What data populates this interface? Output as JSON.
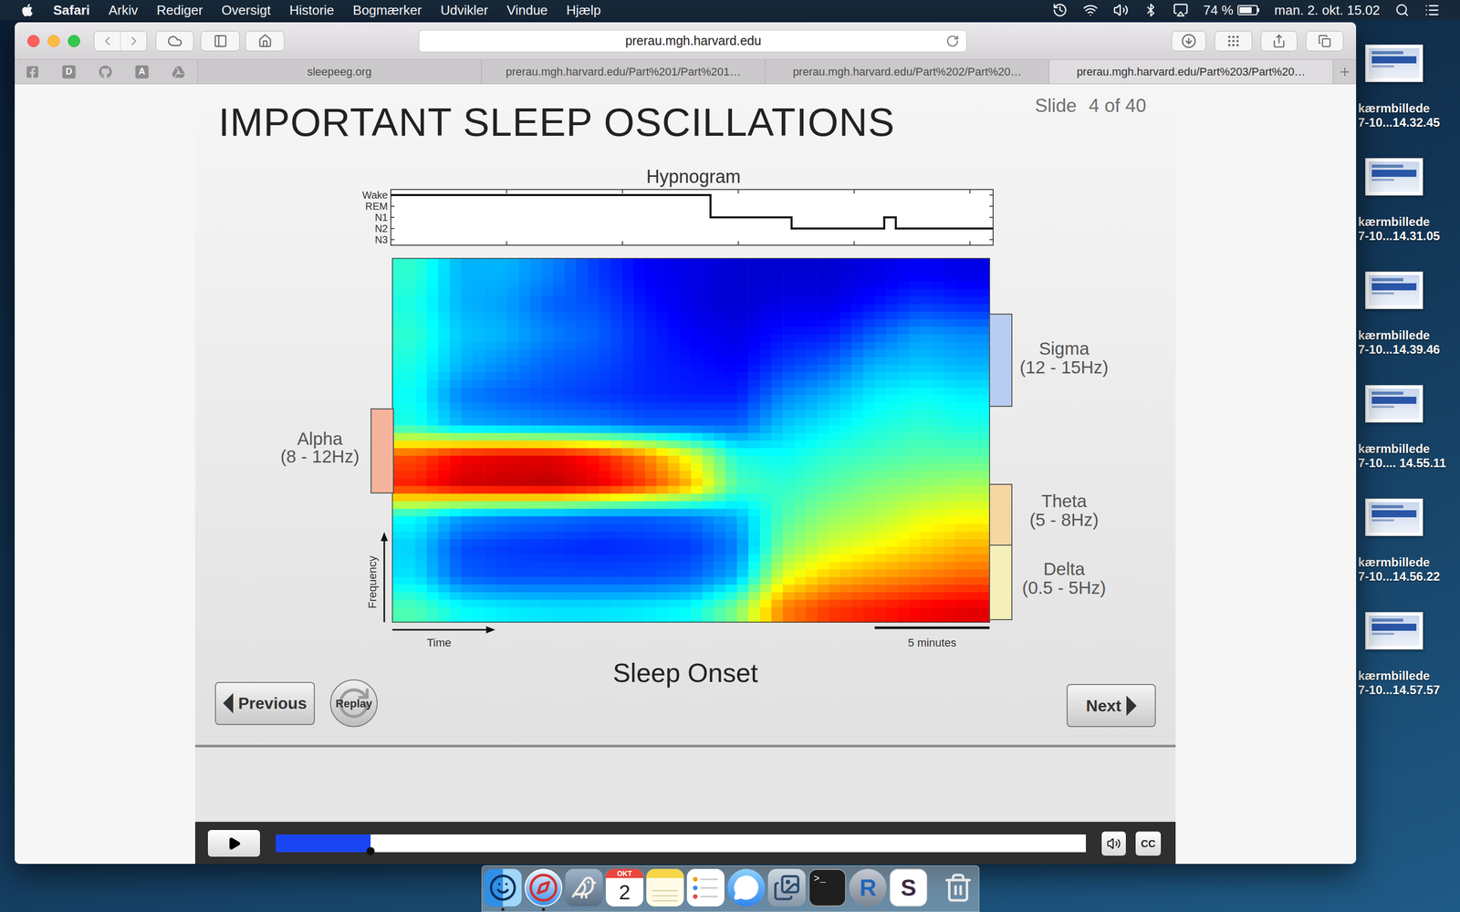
{
  "menu_bar": {
    "app": "Safari",
    "items": [
      "Arkiv",
      "Rediger",
      "Oversigt",
      "Historie",
      "Bogmærker",
      "Udvikler",
      "Vindue",
      "Hjælp"
    ],
    "battery": {
      "reading": "74 %",
      "level": 0.74
    },
    "clock": "man. 2. okt. 15.02"
  },
  "browser": {
    "address": "prerau.mgh.harvard.edu",
    "bookmarks": [
      {
        "kind": "facebook"
      },
      {
        "kind": "letter",
        "label": "D"
      },
      {
        "kind": "github"
      },
      {
        "kind": "letter",
        "label": "A"
      },
      {
        "kind": "drive"
      }
    ],
    "tabs": [
      {
        "label": "sleepeeg.org",
        "selected": false
      },
      {
        "label": "prerau.mgh.harvard.edu/Part%201/Part%201…",
        "selected": false
      },
      {
        "label": "prerau.mgh.harvard.edu/Part%202/Part%20…",
        "selected": false
      },
      {
        "label": "prerau.mgh.harvard.edu/Part%203/Part%20…",
        "selected": true
      }
    ]
  },
  "slide": {
    "title": "IMPORTANT SLEEP OSCILLATIONS",
    "counter_label": "Slide",
    "counter": "4 of 40",
    "caption": "Sleep Onset",
    "previous": "Previous",
    "replay": "Replay",
    "next": "Next"
  },
  "hypnogram": {
    "title": "Hypnogram",
    "stages": [
      "Wake",
      "REM",
      "N1",
      "N2",
      "N3"
    ],
    "duration_min": 26,
    "tick_every_min": 5,
    "segments": [
      {
        "stage": "Wake",
        "from": 0,
        "to": 13.8
      },
      {
        "stage": "N1",
        "from": 13.8,
        "to": 17.3
      },
      {
        "stage": "N2",
        "from": 17.3,
        "to": 21.3
      },
      {
        "stage": "N1",
        "from": 21.3,
        "to": 21.8
      },
      {
        "stage": "N2",
        "from": 21.8,
        "to": 26
      }
    ]
  },
  "spectrogram": {
    "y_label": "Frequency",
    "x_label": "Time",
    "scale_bar": "5 minutes",
    "scale_bar_min": 5,
    "duration_min": 26,
    "max_hz": 24,
    "bin_hz": 2,
    "power": [
      [
        0.45,
        0.35,
        0.33,
        0.38,
        0.85,
        0.8,
        0.4,
        0.38,
        0.4,
        0.42,
        0.4,
        0.42
      ],
      [
        0.38,
        0.22,
        0.2,
        0.28,
        0.92,
        0.88,
        0.3,
        0.25,
        0.3,
        0.32,
        0.3,
        0.3
      ],
      [
        0.36,
        0.2,
        0.18,
        0.25,
        0.93,
        0.9,
        0.28,
        0.22,
        0.26,
        0.3,
        0.28,
        0.3
      ],
      [
        0.35,
        0.2,
        0.17,
        0.24,
        0.94,
        0.9,
        0.26,
        0.2,
        0.22,
        0.25,
        0.22,
        0.25
      ],
      [
        0.35,
        0.2,
        0.16,
        0.22,
        0.9,
        0.85,
        0.25,
        0.18,
        0.2,
        0.22,
        0.2,
        0.18
      ],
      [
        0.36,
        0.2,
        0.17,
        0.22,
        0.82,
        0.75,
        0.22,
        0.16,
        0.16,
        0.16,
        0.14,
        0.12
      ],
      [
        0.38,
        0.22,
        0.18,
        0.24,
        0.7,
        0.6,
        0.22,
        0.15,
        0.14,
        0.12,
        0.1,
        0.1
      ],
      [
        0.5,
        0.3,
        0.25,
        0.3,
        0.45,
        0.4,
        0.22,
        0.15,
        0.12,
        0.1,
        0.08,
        0.08
      ],
      [
        0.75,
        0.6,
        0.5,
        0.45,
        0.42,
        0.38,
        0.32,
        0.25,
        0.18,
        0.14,
        0.1,
        0.08
      ],
      [
        0.82,
        0.68,
        0.58,
        0.52,
        0.46,
        0.42,
        0.36,
        0.3,
        0.22,
        0.15,
        0.1,
        0.08
      ],
      [
        0.85,
        0.72,
        0.62,
        0.55,
        0.5,
        0.44,
        0.4,
        0.36,
        0.3,
        0.22,
        0.14,
        0.1
      ],
      [
        0.88,
        0.75,
        0.66,
        0.6,
        0.52,
        0.46,
        0.42,
        0.38,
        0.32,
        0.28,
        0.18,
        0.12
      ],
      [
        0.9,
        0.78,
        0.7,
        0.62,
        0.54,
        0.46,
        0.4,
        0.36,
        0.3,
        0.26,
        0.16,
        0.1
      ]
    ]
  },
  "bands": [
    {
      "name": "Alpha",
      "range": "(8 - 12Hz)",
      "color": "#f4b49c"
    },
    {
      "name": "Sigma",
      "range": "(12 - 15Hz)",
      "color": "#b9cdf2"
    },
    {
      "name": "Theta",
      "range": "(5 - 8Hz)",
      "color": "#f5d7a3"
    },
    {
      "name": "Delta",
      "range": "(0.5 - 5Hz)",
      "color": "#f5f0ba"
    }
  ],
  "player": {
    "playing": false,
    "level": 0.117,
    "captions": "CC"
  },
  "desktop_icons": [
    {
      "title": "kærmbillede",
      "subtitle": "7-10...14.32.45"
    },
    {
      "title": "kærmbillede",
      "subtitle": "7-10...14.31.05"
    },
    {
      "title": "kærmbillede",
      "subtitle": "7-10...14.39.46"
    },
    {
      "title": "kærmbillede",
      "subtitle": "7-10.... 14.55.11"
    },
    {
      "title": "kærmbillede",
      "subtitle": "7-10...14.56.22"
    },
    {
      "title": "kærmbillede",
      "subtitle": "7-10...14.57.57"
    }
  ],
  "dock": [
    {
      "kind": "finder",
      "running": true
    },
    {
      "kind": "safari",
      "running": true
    },
    {
      "kind": "bird",
      "running": false
    },
    {
      "kind": "calendar",
      "month": "OKT",
      "day": "2",
      "running": false
    },
    {
      "kind": "notes",
      "running": false
    },
    {
      "kind": "reminders",
      "running": false
    },
    {
      "kind": "messages",
      "running": false
    },
    {
      "kind": "preview",
      "running": false
    },
    {
      "kind": "terminal",
      "label": ">_",
      "running": false
    },
    {
      "kind": "r",
      "label": "R",
      "running": false
    },
    {
      "kind": "slack",
      "label": "S",
      "running": false
    },
    {
      "kind": "separator",
      "running": false
    },
    {
      "kind": "trash",
      "running": false
    }
  ]
}
